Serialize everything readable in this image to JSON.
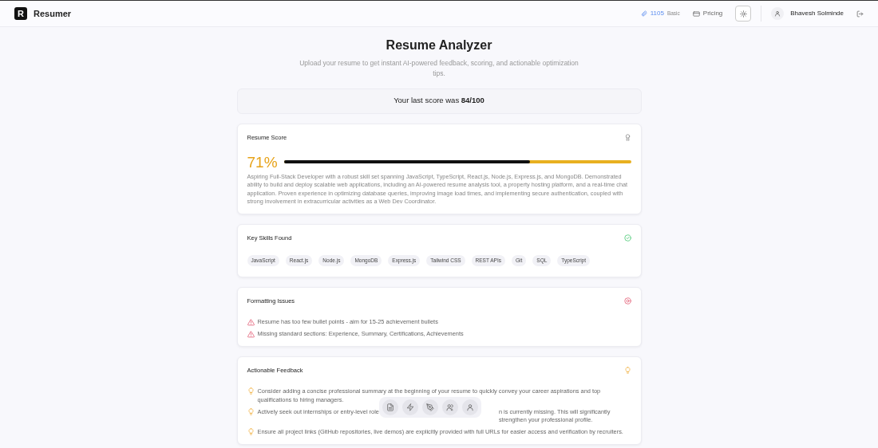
{
  "navbar": {
    "brand_letter": "R",
    "brand": "Resumer",
    "credits": "1105",
    "plan": "Basic",
    "pricing": "Pricing",
    "user": "Bhavesh Solminde"
  },
  "header": {
    "title": "Resume Analyzer",
    "subtitle": "Upload your resume to get instant AI-powered feedback, scoring, and actionable optimization tips."
  },
  "last_score": {
    "label": "Your last score was",
    "value": "84/100"
  },
  "score_card": {
    "title": "Resume Score",
    "percent": "71%",
    "level": 0.71,
    "summary": "Aspiring Full-Stack Developer with a robust skill set spanning JavaScript, TypeScript, React.js, Node.js, Express.js, and MongoDB. Demonstrated ability to build and deploy scalable web applications, including an AI-powered resume analysis tool, a property hosting platform, and a real-time chat application. Proven experience in optimizing database queries, improving image load times, and implementing secure authentication, coupled with strong involvement in extracurricular activities as a Web Dev Coordinator."
  },
  "skills_card": {
    "title": "Key Skills Found",
    "skills": [
      "JavaScript",
      "React.js",
      "Node.js",
      "MongoDB",
      "Express.js",
      "Tailwind CSS",
      "REST APIs",
      "Git",
      "SQL",
      "TypeScript"
    ]
  },
  "issues_card": {
    "title": "Formatting Issues",
    "issues": [
      "Resume has too few bullet points - aim for 15-25 achievement bullets",
      "Missing standard sections: Experience, Summary, Certifications, Achievements"
    ]
  },
  "feedback_card": {
    "title": "Actionable Feedback",
    "items": [
      {
        "before": "Consider adding a concise professional summary at the beginning of your resume to quickly convey your career aspirations and top qualifications to hiring managers."
      },
      {
        "before": "Actively seek out internships or entry-level role",
        "after": "n is currently missing. This will significantly strengthen your professional profile."
      },
      {
        "before": "Ensure all project links (GitHub repositories, live demos) are explicitly provided with full URLs for easier access and verification by recruiters."
      }
    ]
  },
  "dock": {
    "icons": [
      {
        "kind": "document"
      },
      {
        "kind": "bolt"
      },
      {
        "kind": "pen"
      },
      {
        "kind": "users"
      },
      {
        "kind": "user"
      }
    ]
  }
}
